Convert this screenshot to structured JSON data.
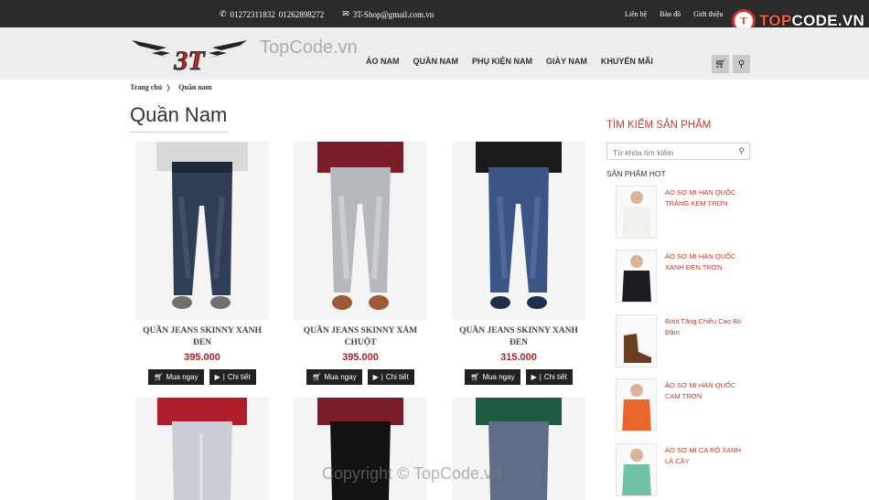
{
  "topbar": {
    "phone1": "01272311832",
    "phone2": "01262898272",
    "email": "3T-Shop@gmail.com.vn",
    "links": [
      "Liên hệ",
      "Bản đồ",
      "Giới thiệu"
    ],
    "phone_icon": "phone-icon",
    "mail_icon": "mail-icon"
  },
  "brand_badge": {
    "mark": "T",
    "text_main": "TOP",
    "text_rest": "CODE.VN"
  },
  "header": {
    "logo_text": "3T",
    "watermark": "TopCode.vn",
    "nav": [
      "ÁO NAM",
      "QUẦN NAM",
      "PHỤ KIỆN NAM",
      "GIÀY NAM",
      "KHUYẾN MÃI"
    ],
    "cart_icon": "cart-icon",
    "search_icon": "search-icon"
  },
  "breadcrumb": {
    "home": "Trang chủ",
    "separator": "〉",
    "current": "Quần nam"
  },
  "page_title": "Quần Nam",
  "products": [
    {
      "name": "QUẦN JEANS SKINNY XANH ĐEN",
      "price": "395.000",
      "buy": "Mua ngay",
      "detail": "Chi tiết"
    },
    {
      "name": "QUẦN JEANS SKINNY XÁM CHUỘT",
      "price": "395.000",
      "buy": "Mua ngay",
      "detail": "Chi tiết"
    },
    {
      "name": "QUẦN JEANS SKINNY XANH ĐEN",
      "price": "315.000",
      "buy": "Mua ngay",
      "detail": "Chi tiết"
    }
  ],
  "sidebar": {
    "search_title": "TÌM KIẾM SẢN PHẨM",
    "search_placeholder": "Từ khóa tìm kiếm",
    "hot_title": "SẢN PHẨM HOT",
    "hot_items": [
      {
        "label": "ÁO SƠ MI HÀN QUỐC TRẮNG KEM TRƠN"
      },
      {
        "label": "ÁO SƠ MI HÀN QUỐC XANH ĐEN TRƠN"
      },
      {
        "label": "Boot Tăng Chiều Cao Bò Đậm"
      },
      {
        "label": "ÁO SƠ MI HÀN QUỐC CAM TRƠN"
      },
      {
        "label": "ÁO SƠ MI CA RÔ XANH LÁ CÂY"
      }
    ]
  },
  "copyright": "Copyright © TopCode.vn",
  "colors": {
    "accent": "#a8202a",
    "sidebar_red": "#c0392b",
    "topbar_bg": "#2b2b2b",
    "header_bg": "#ededed"
  }
}
